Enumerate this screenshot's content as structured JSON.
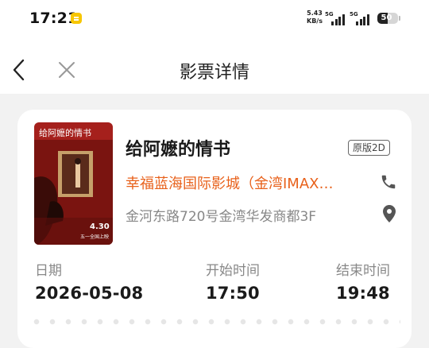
{
  "status_bar": {
    "time": "17:21",
    "net_speed_value": "5.43",
    "net_speed_unit": "KB/s",
    "signal_1_label": "5G",
    "signal_2_label": "5G",
    "battery_level": "50",
    "battery_fraction": 0.5,
    "notification_icon": "message-notification-icon"
  },
  "nav": {
    "title": "影票详情",
    "back_icon": "chevron-left-icon",
    "close_icon": "close-icon"
  },
  "ticket": {
    "movie_title": "给阿嬷的情书",
    "version": "原版2D",
    "cinema_name": "幸福蓝海国际影城（金湾IMAX…",
    "address": "金河东路720号金湾华发商都3F",
    "poster": {
      "title": "给阿嬷的情书",
      "date": "4.30",
      "tagline": "五一全国上映"
    },
    "date_label": "日期",
    "date_value": "2026-05-08",
    "start_label": "开始时间",
    "start_value": "17:50",
    "end_label": "结束时间",
    "end_value": "19:48"
  },
  "colors": {
    "accent": "#e8611b",
    "background": "#f2f2f2",
    "card": "#ffffff",
    "poster_red": "#a5201c"
  }
}
